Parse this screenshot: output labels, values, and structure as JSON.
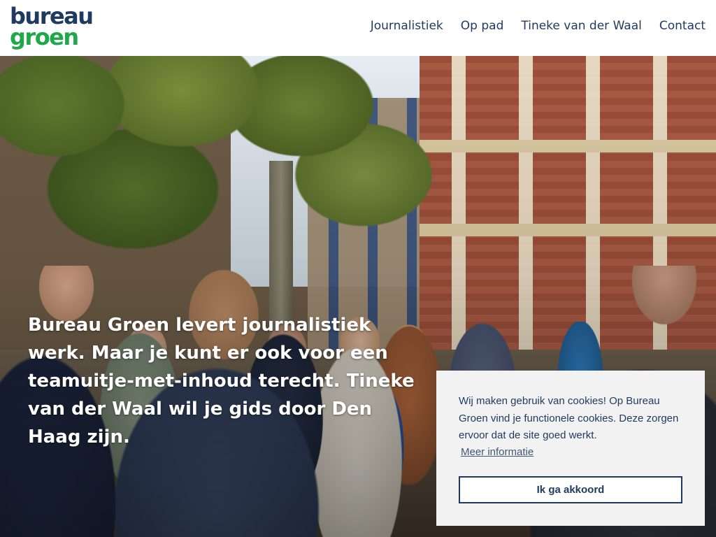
{
  "logo": {
    "line1": "bureau",
    "line2": "groen",
    "colors": {
      "line1": "#1f3a5f",
      "line2": "#1fa84a"
    }
  },
  "nav": {
    "items": [
      {
        "label": "Journalistiek"
      },
      {
        "label": "Op pad"
      },
      {
        "label": "Tineke van der Waal"
      },
      {
        "label": "Contact"
      }
    ]
  },
  "hero": {
    "text": "Bureau Groen levert journalistiek werk. Maar je kunt er ook voor een teamuitje-met-inhoud terecht. Tineke van der Waal wil je gids door Den Haag zijn."
  },
  "cookie_banner": {
    "message": "Wij maken gebruik van cookies! Op Bureau Groen vind je functionele cookies. Deze zorgen ervoor dat de site goed werkt.",
    "link_label": "Meer informatie",
    "button_label": "Ik ga akkoord",
    "colors": {
      "background": "#f2f2f2",
      "text": "#1f3a5f"
    }
  }
}
